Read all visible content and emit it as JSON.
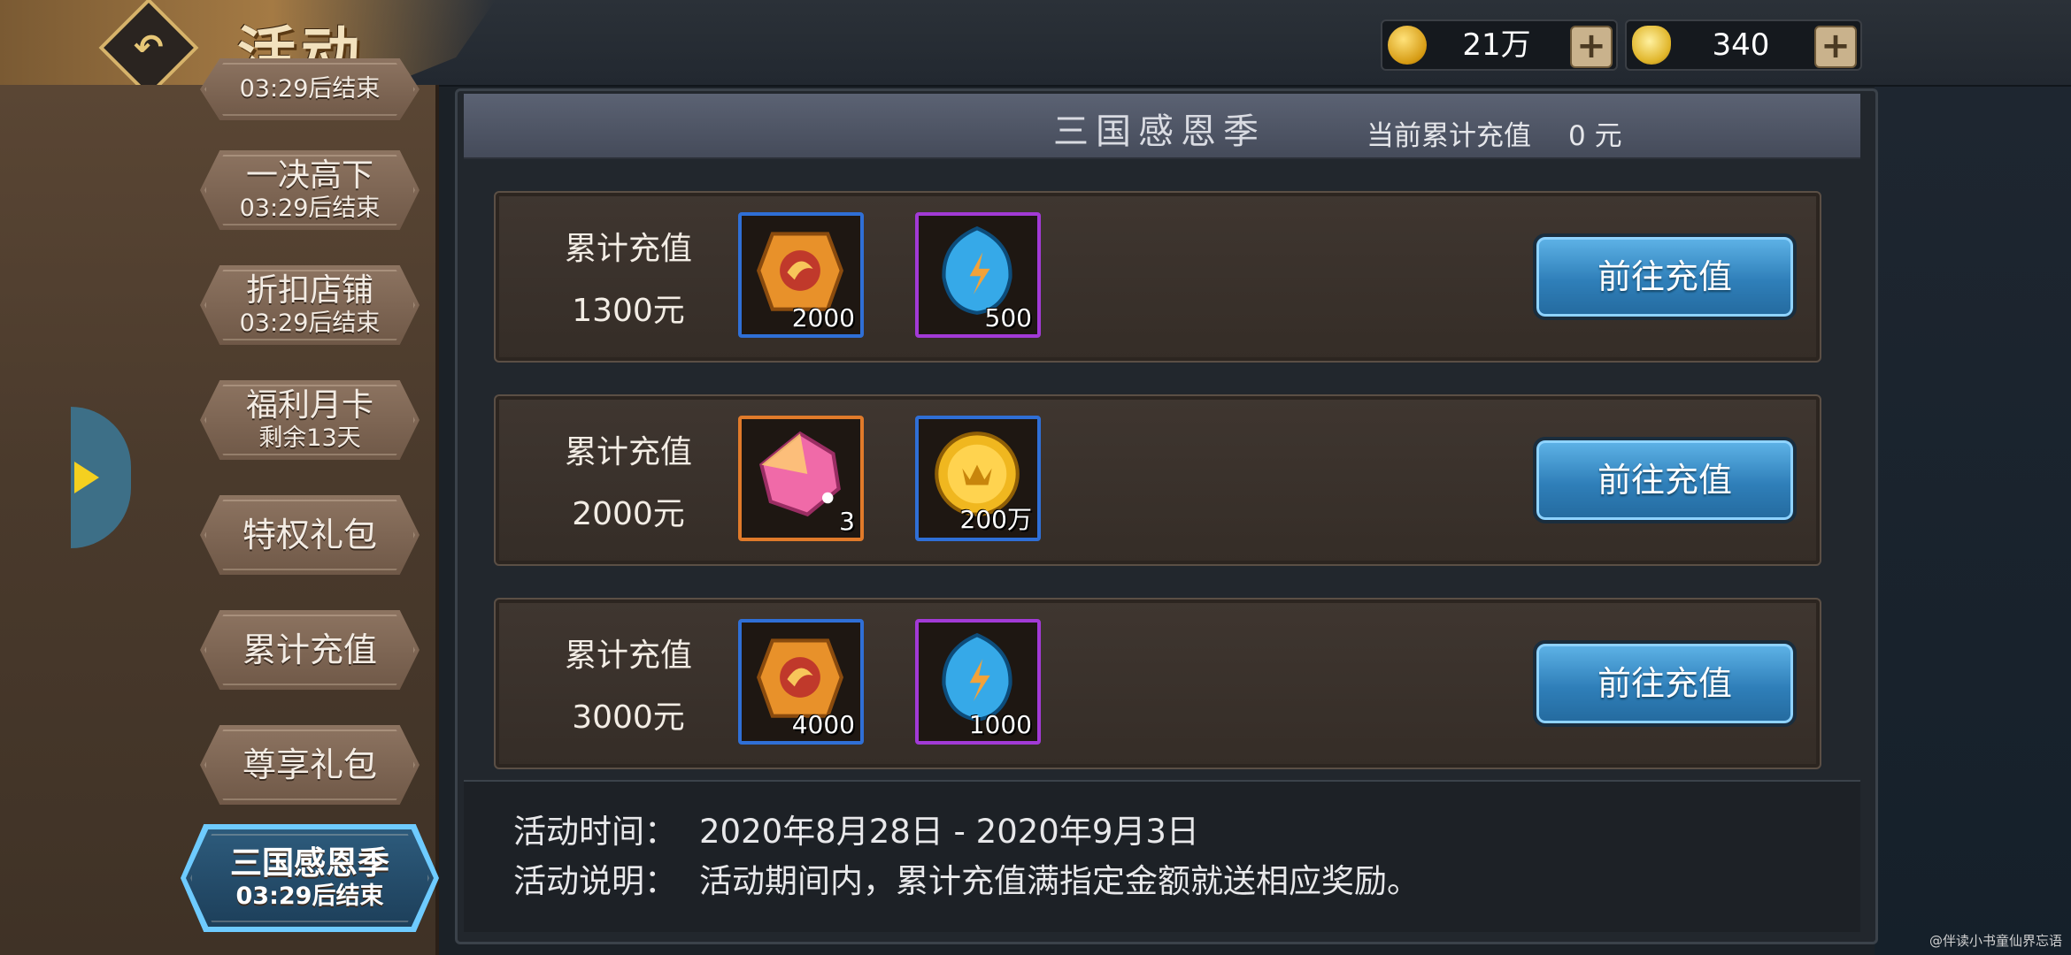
{
  "header": {
    "title": "活动",
    "back_icon": "back-arrow-icon",
    "currencies": [
      {
        "icon": "gold-coin-icon",
        "value": "21万"
      },
      {
        "icon": "ingot-icon",
        "value": "340"
      }
    ],
    "plus_label": "+"
  },
  "sidebar": {
    "items": [
      {
        "title": "",
        "subtitle": "03:29后结束"
      },
      {
        "title": "一决高下",
        "subtitle": "03:29后结束"
      },
      {
        "title": "折扣店铺",
        "subtitle": "03:29后结束"
      },
      {
        "title": "福利月卡",
        "subtitle": "剩余13天"
      },
      {
        "title": "特权礼包",
        "subtitle": ""
      },
      {
        "title": "累计充值",
        "subtitle": ""
      },
      {
        "title": "尊享礼包",
        "subtitle": ""
      },
      {
        "title": "三国感恩季",
        "subtitle": "03:29后结束",
        "active": true
      }
    ]
  },
  "panel": {
    "title": "三国感恩季",
    "recharge_label": "当前累计充值",
    "recharge_value": "0 元"
  },
  "tiers": [
    {
      "label": "累计充值",
      "amount": "1300元",
      "rewards": [
        {
          "icon": "orange-token-icon",
          "quantity": "2000",
          "rarity": "blue"
        },
        {
          "icon": "blue-crystal-icon",
          "quantity": "500",
          "rarity": "purple"
        }
      ],
      "button": "前往充值"
    },
    {
      "label": "累计充值",
      "amount": "2000元",
      "rewards": [
        {
          "icon": "pink-gem-icon",
          "quantity": "3",
          "rarity": "orange"
        },
        {
          "icon": "gold-coin-icon",
          "quantity": "200万",
          "rarity": "blue"
        }
      ],
      "button": "前往充值"
    },
    {
      "label": "累计充值",
      "amount": "3000元",
      "rewards": [
        {
          "icon": "orange-token-icon",
          "quantity": "4000",
          "rarity": "blue"
        },
        {
          "icon": "blue-crystal-icon",
          "quantity": "1000",
          "rarity": "purple"
        }
      ],
      "button": "前往充值"
    }
  ],
  "info": {
    "time_label": "活动时间：",
    "time_value": "2020年8月28日 - 2020年9月3日",
    "desc_label": "活动说明：",
    "desc_value": "活动期间内，累计充值满指定金额就送相应奖励。"
  },
  "watermark": "@伴读小书童仙界忘语",
  "colors": {
    "button_blue": "#3a8fcf",
    "active_tab_glow": "#57c6ff",
    "rarity_blue": "#2f6fd6",
    "rarity_purple": "#a23ad6",
    "rarity_orange": "#e07a2a"
  }
}
